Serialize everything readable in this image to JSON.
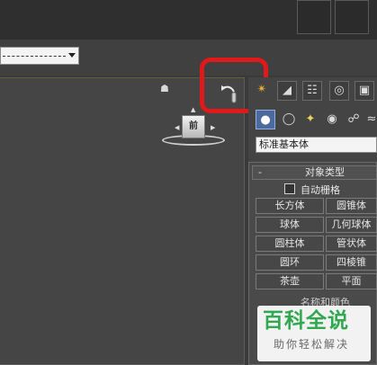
{
  "colors": {
    "highlight": "#e0191b",
    "watermark_green": "#2fa84f",
    "active_tab": "#4d6a9c"
  },
  "view_dropdown": {
    "value": ""
  },
  "viewport": {
    "home_icon": "home-icon",
    "undo_view_icon": "undo-view-icon",
    "viewcube_label": "前"
  },
  "command_panel": {
    "tab_icons": [
      "create-icon",
      "modify-icon",
      "hierarchy-icon",
      "motion-icon",
      "display-icon"
    ],
    "sub_icons": [
      "geometry-icon",
      "shapes-icon",
      "lights-icon",
      "cameras-icon",
      "helpers-icon"
    ],
    "category": "标准基本体",
    "rollout": {
      "toggle": "-",
      "title": "对象类型",
      "autogrid_label": "自动栅格",
      "buttons": [
        "长方体",
        "圆锥体",
        "球体",
        "几何球体",
        "圆柱体",
        "管状体",
        "圆环",
        "四棱锥",
        "茶壶",
        "平面"
      ]
    },
    "name_color_title": "名称和颜色"
  },
  "watermark": {
    "title": "百科全说",
    "subtitle": "助你轻松解决"
  }
}
